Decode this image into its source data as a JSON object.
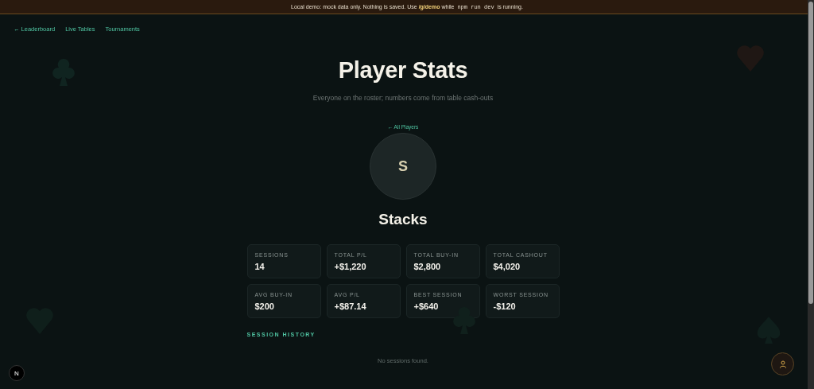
{
  "banner": {
    "lead": "Local demo: mock data only. Nothing is saved. Use **/g/demo** while",
    "code": "npm run dev",
    "tail": "is running."
  },
  "nav": [
    {
      "label": "← Leaderboard"
    },
    {
      "label": "Live Tables"
    },
    {
      "label": "Tournaments"
    }
  ],
  "title": "Player Stats",
  "subtitle": "Everyone on the roster; numbers come from table cash-outs",
  "back_link": "← All Players",
  "player": {
    "initial": "S",
    "name": "Stacks"
  },
  "stats": [
    {
      "label": "SESSIONS",
      "value": "14"
    },
    {
      "label": "TOTAL P/L",
      "value": "+$1,220"
    },
    {
      "label": "TOTAL BUY-IN",
      "value": "$2,800"
    },
    {
      "label": "TOTAL CASHOUT",
      "value": "$4,020"
    },
    {
      "label": "AVG BUY-IN",
      "value": "$200"
    },
    {
      "label": "AVG P/L",
      "value": "+$87.14"
    },
    {
      "label": "BEST SESSION",
      "value": "+$640"
    },
    {
      "label": "WORST SESSION",
      "value": "-$120"
    }
  ],
  "session_history": {
    "heading": "SESSION HISTORY",
    "empty_message": "No sessions found."
  },
  "dev_badge": "N"
}
